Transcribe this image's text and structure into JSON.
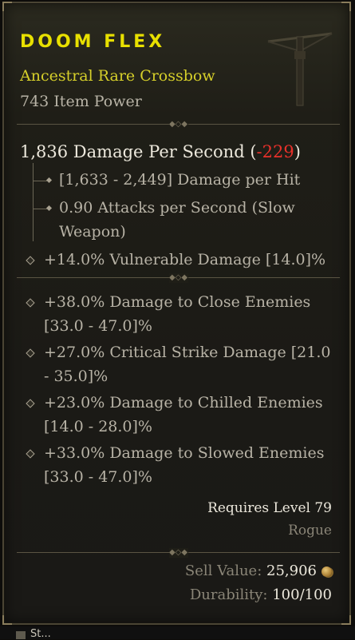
{
  "item": {
    "name": "DOOM FLEX",
    "type_line": "Ancestral Rare Crossbow",
    "item_power": "743 Item Power",
    "icon": "crossbow-icon"
  },
  "stats": {
    "dps_value": "1,836 Damage Per Second",
    "dps_change_open": "(",
    "dps_change": "-229",
    "dps_change_close": ")",
    "damage_per_hit": "[1,633 - 2,449] Damage per Hit",
    "attacks_per_second": "0.90 Attacks per Second (Slow Weapon)",
    "implicit": "+14.0% Vulnerable Damage [14.0]%"
  },
  "affixes": [
    "+38.0% Damage to Close Enemies [33.0 - 47.0]%",
    "+27.0% Critical Strike Damage [21.0 - 35.0]%",
    "+23.0% Damage to Chilled Enemies [14.0 - 28.0]%",
    "+33.0% Damage to Slowed Enemies [33.0 - 47.0]%"
  ],
  "requirements": {
    "level": "Requires Level 79",
    "class": "Rogue"
  },
  "footer": {
    "sell_label": "Sell Value:",
    "sell_value": "25,906",
    "gold_icon": "gold-coin-icon",
    "durability_label": "Durability:",
    "durability_value": "100/100"
  },
  "colors": {
    "name": "#e8e000",
    "type_line": "#d6cf2a",
    "negative": "#e8312a",
    "text": "#b8b3a6",
    "bright": "#ece8dc"
  },
  "bottom": {
    "text": "St..."
  }
}
